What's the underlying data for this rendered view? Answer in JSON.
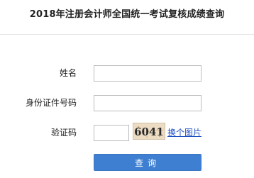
{
  "header": {
    "title": "2018年注册会计师全国统一考试复核成绩查询"
  },
  "form": {
    "name_label": "姓名",
    "name_value": "",
    "id_label": "身份证件号码",
    "id_value": "",
    "captcha_label": "验证码",
    "captcha_value": "",
    "captcha_image_text": "6041",
    "refresh_link": "换个图片",
    "submit_label": "查询"
  },
  "colors": {
    "button_bg": "#3f7fd1",
    "link": "#1d4fc1"
  }
}
